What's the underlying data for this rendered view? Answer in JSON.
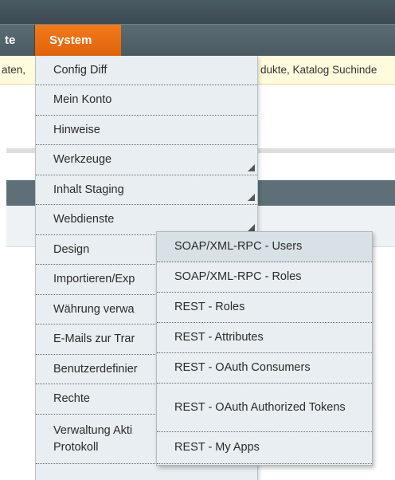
{
  "nav": {
    "left_item_label": "te",
    "system_label": "System"
  },
  "notice": {
    "left_text": "aten,",
    "right_text": "dukte, Katalog Suchinde"
  },
  "system_menu": {
    "items": [
      {
        "label": "Config Diff",
        "has_submenu": false
      },
      {
        "label": "Mein Konto",
        "has_submenu": false
      },
      {
        "label": "Hinweise",
        "has_submenu": false
      },
      {
        "label": "Werkzeuge",
        "has_submenu": true
      },
      {
        "label": "Inhalt Staging",
        "has_submenu": true
      },
      {
        "label": "Webdienste",
        "has_submenu": true
      },
      {
        "label": "Design",
        "has_submenu": false
      },
      {
        "label": "Importieren/Exp",
        "has_submenu": false
      },
      {
        "label": "Währung verwa",
        "has_submenu": false
      },
      {
        "label": "E-Mails zur Trar",
        "has_submenu": false
      },
      {
        "label": "Benutzerdefinier",
        "has_submenu": false
      },
      {
        "label": "Rechte",
        "has_submenu": false
      },
      {
        "label": "Verwaltung Akti Protokoll",
        "has_submenu": true
      }
    ]
  },
  "webdienste_submenu": {
    "items": [
      {
        "label": "SOAP/XML-RPC - Users",
        "hovered": true
      },
      {
        "label": "SOAP/XML-RPC - Roles",
        "hovered": false
      },
      {
        "label": "REST - Roles",
        "hovered": false
      },
      {
        "label": "REST - Attributes",
        "hovered": false
      },
      {
        "label": "REST - OAuth Consumers",
        "hovered": false
      },
      {
        "label": "REST - OAuth Authorized Tokens",
        "hovered": false
      },
      {
        "label": "REST - My Apps",
        "hovered": false
      }
    ]
  },
  "colors": {
    "accent_orange": "#eb6e12",
    "menu_bg": "#e8eef1",
    "nav_bg": "#55656d"
  }
}
